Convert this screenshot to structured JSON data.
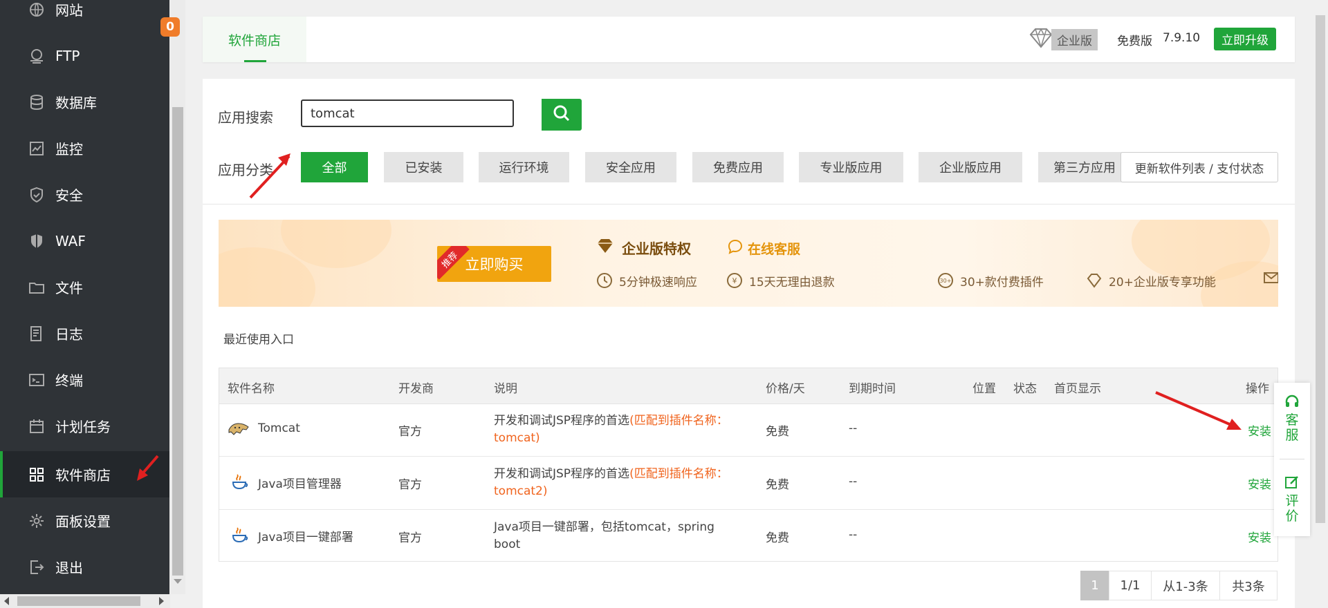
{
  "sidebar": {
    "items": [
      {
        "label": "网站",
        "icon": "globe-icon"
      },
      {
        "label": "FTP",
        "icon": "ftp-icon"
      },
      {
        "label": "数据库",
        "icon": "database-icon"
      },
      {
        "label": "监控",
        "icon": "monitor-icon"
      },
      {
        "label": "安全",
        "icon": "shield-icon"
      },
      {
        "label": "WAF",
        "icon": "waf-shield-icon"
      },
      {
        "label": "文件",
        "icon": "folder-icon"
      },
      {
        "label": "日志",
        "icon": "log-icon"
      },
      {
        "label": "终端",
        "icon": "terminal-icon"
      },
      {
        "label": "计划任务",
        "icon": "calendar-icon"
      },
      {
        "label": "软件商店",
        "icon": "grid-icon",
        "active": true
      },
      {
        "label": "面板设置",
        "icon": "gear-icon"
      },
      {
        "label": "退出",
        "icon": "logout-icon"
      }
    ],
    "badge": "0"
  },
  "header": {
    "tab": "软件商店",
    "enterprise": "企业版",
    "free": "免费版",
    "version": "7.9.10",
    "upgrade": "立即升级"
  },
  "search": {
    "label": "应用搜索",
    "value": "tomcat"
  },
  "categories": {
    "label": "应用分类",
    "items": [
      "全部",
      "已安装",
      "运行环境",
      "安全应用",
      "免费应用",
      "专业版应用",
      "企业版应用",
      "第三方应用"
    ],
    "active": "全部",
    "refresh": "更新软件列表 / 支付状态"
  },
  "banner": {
    "ribbon": "推荐",
    "buy": "立即购买",
    "title": "企业版特权",
    "service": "在线客服",
    "features": [
      "5分钟极速响应",
      "15天无理由退款",
      "30+款付费插件",
      "20+企业版专享功能"
    ]
  },
  "recent": "最近使用入口",
  "table": {
    "headers": [
      "软件名称",
      "开发商",
      "说明",
      "价格/天",
      "到期时间",
      "位置",
      "状态",
      "首页显示",
      "操作"
    ],
    "rows": [
      {
        "name": "Tomcat",
        "dev": "官方",
        "desc": "开发和调试JSP程序的首选",
        "match": "(匹配到插件名称：tomcat)",
        "price": "免费",
        "expire": "--",
        "action": "安装"
      },
      {
        "name": "Java项目管理器",
        "dev": "官方",
        "desc": "开发和调试JSP程序的首选",
        "match": "(匹配到插件名称：tomcat2)",
        "price": "免费",
        "expire": "--",
        "action": "安装"
      },
      {
        "name": "Java项目一键部署",
        "dev": "官方",
        "desc": "Java项目一键部署，包括tomcat，spring boot",
        "match": "",
        "price": "免费",
        "expire": "--",
        "action": "安装"
      }
    ]
  },
  "pagination": {
    "current": "1",
    "pages": "1/1",
    "range": "从1-3条",
    "total": "共3条"
  },
  "float_panel": {
    "service": "客服",
    "review": "评价"
  },
  "colors": {
    "accent": "#20a53a",
    "sidebar": "#2f3337",
    "highlight": "#f0641e",
    "annotation": "#e02020"
  }
}
